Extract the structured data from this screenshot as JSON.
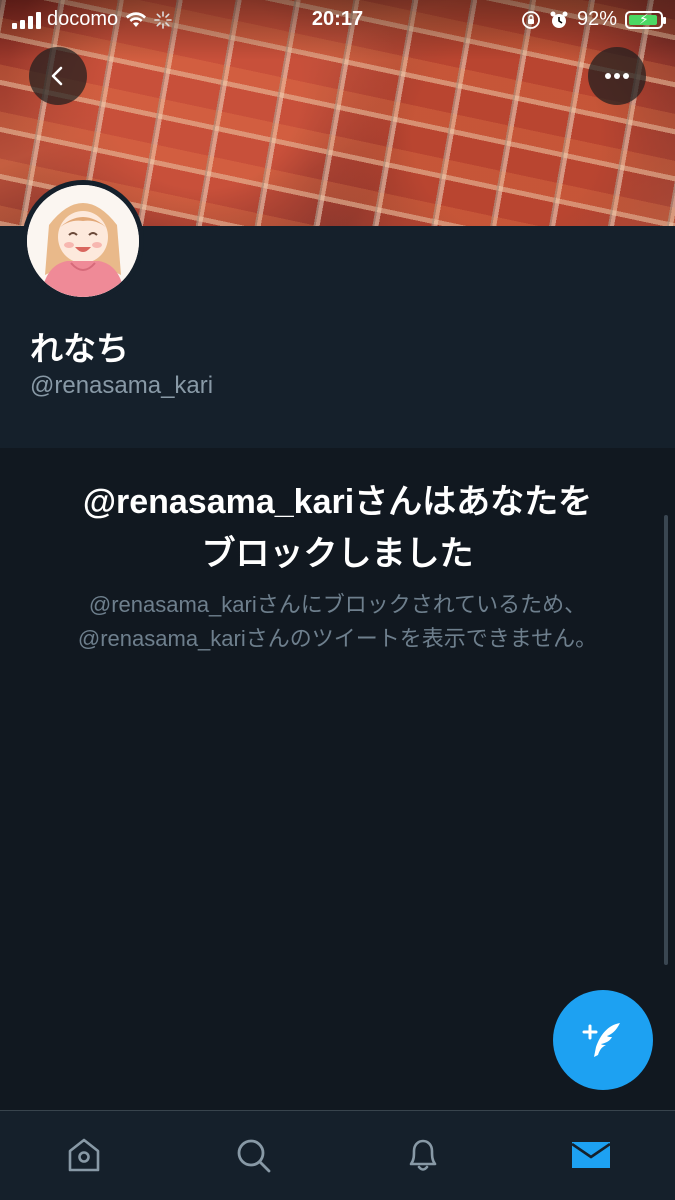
{
  "status_bar": {
    "carrier": "docomo",
    "time": "20:17",
    "battery": "92%",
    "battery_level": 0.92
  },
  "header": {
    "back_icon": "chevron-left-icon",
    "more_icon": "more-horizontal-icon"
  },
  "profile": {
    "display_name": "れなち",
    "handle": "@renasama_kari"
  },
  "blocked": {
    "title_line1": "@renasama_kariさんはあなたを",
    "title_line2": "ブロックしました",
    "description_line1": "@renasama_kariさんにブロックされているため、",
    "description_line2": "@renasama_kariさんのツイートを表示できません。"
  },
  "fab": {
    "icon": "compose-tweet-icon"
  },
  "tab_bar": {
    "tabs": [
      {
        "name": "home",
        "icon": "home-icon",
        "active": false
      },
      {
        "name": "search",
        "icon": "search-icon",
        "active": false
      },
      {
        "name": "notifications",
        "icon": "bell-icon",
        "active": false
      },
      {
        "name": "messages",
        "icon": "mail-icon",
        "active": true
      }
    ]
  },
  "colors": {
    "accent": "#1da1f2",
    "background": "#15202b",
    "secondary_text": "#8899a6"
  }
}
